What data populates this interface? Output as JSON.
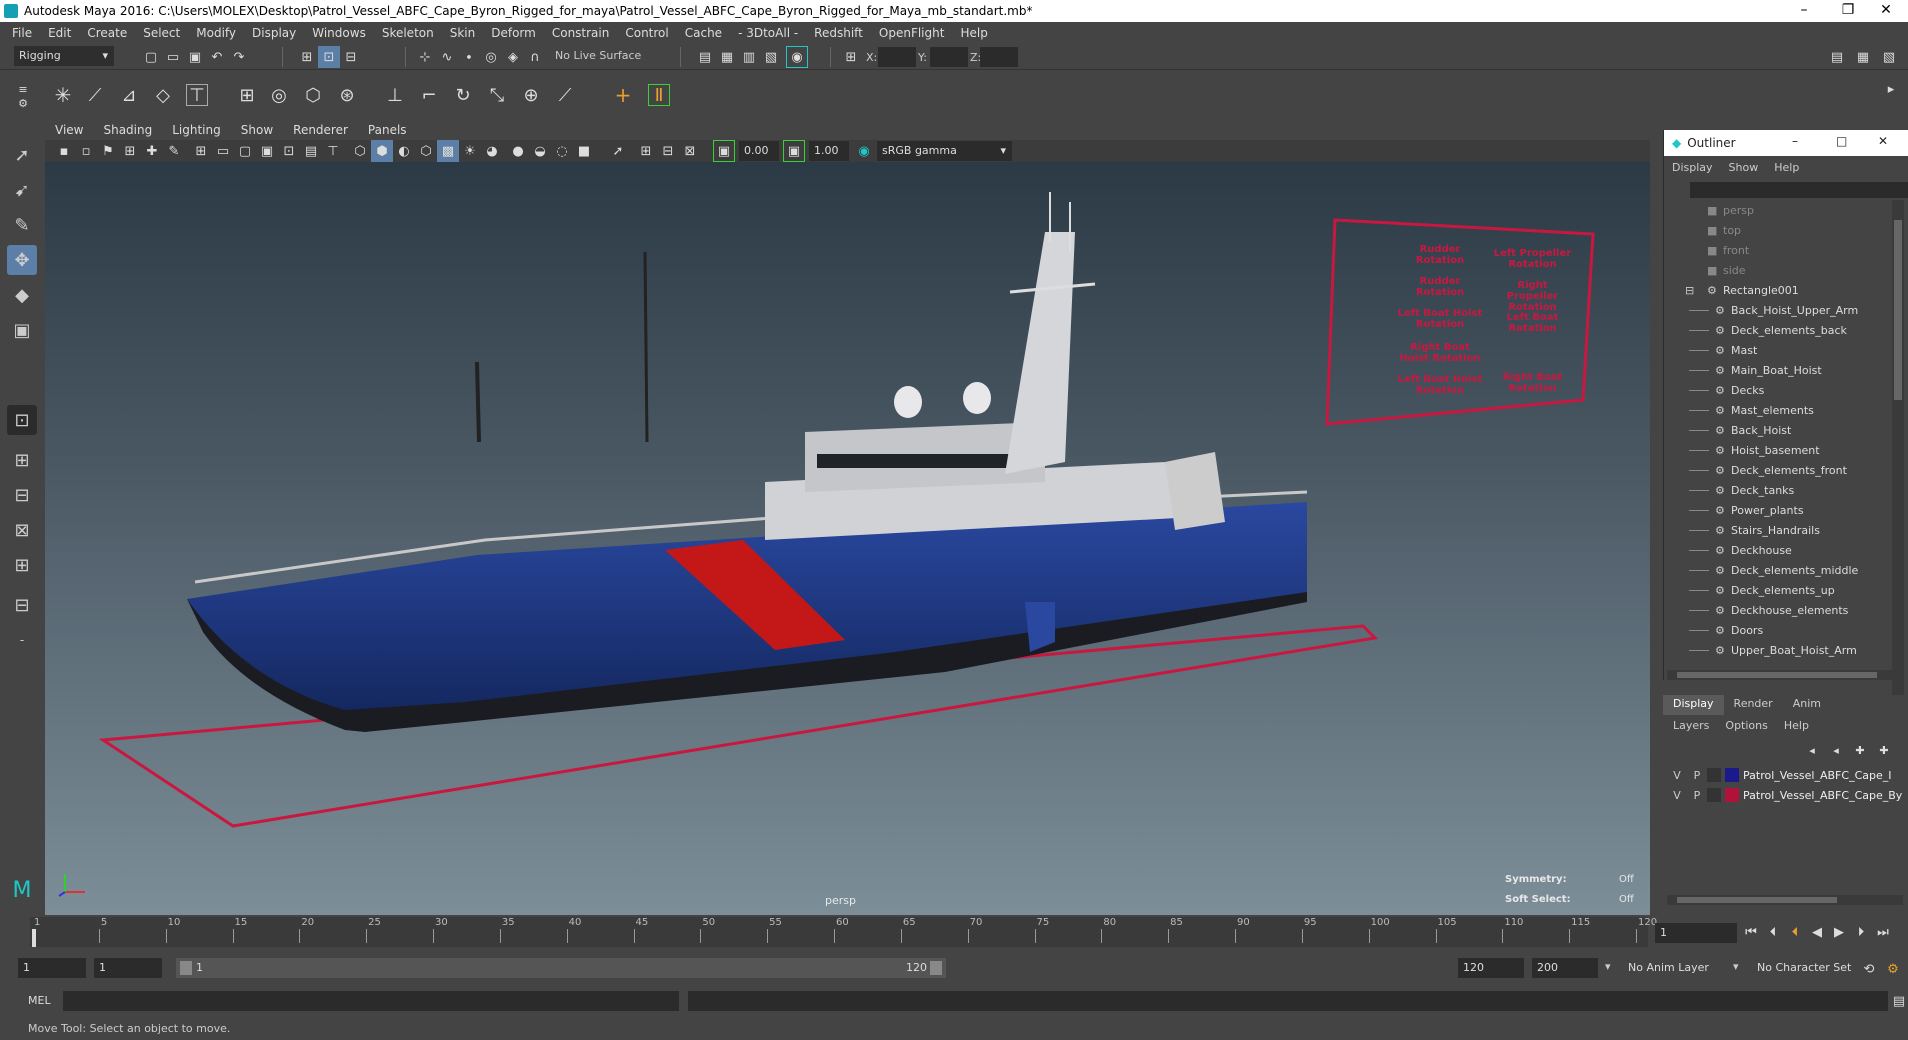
{
  "title": "Autodesk Maya 2016: C:\\Users\\MOLEX\\Desktop\\Patrol_Vessel_ABFC_Cape_Byron_Rigged_for_maya\\Patrol_Vessel_ABFC_Cape_Byron_Rigged_for_Maya_mb_standart.mb*",
  "menu": [
    "File",
    "Edit",
    "Create",
    "Select",
    "Modify",
    "Display",
    "Windows",
    "Skeleton",
    "Skin",
    "Deform",
    "Constrain",
    "Control",
    "Cache",
    "- 3DtoAll -",
    "Redshift",
    "OpenFlight",
    "Help"
  ],
  "status": {
    "mode": "Rigging",
    "live_surface": "No Live Surface",
    "x": "X:",
    "y": "Y:",
    "z": "Z:"
  },
  "panel_menu": [
    "View",
    "Shading",
    "Lighting",
    "Show",
    "Renderer",
    "Panels"
  ],
  "panel_tools": {
    "val1": "0.00",
    "val2": "1.00",
    "color_space": "sRGB gamma"
  },
  "viewport": {
    "camera": "persp",
    "symmetry_label": "Symmetry:",
    "symmetry_value": "Off",
    "soft_label": "Soft Select:",
    "soft_value": "Off"
  },
  "controls_panel": [
    "Rudder Rotation",
    "Left Propeller Rotation",
    "Rudder Rotation",
    "Right Propeller Rotation",
    "Left Boat Hoist Rotation",
    "Left Boat Rotation",
    "Right Boat Hoist Rotation",
    "Left Boat Hoist Rotation",
    "Right Boat Rotation"
  ],
  "outliner": {
    "title": "Outliner",
    "menu": [
      "Display",
      "Show",
      "Help"
    ],
    "items": [
      {
        "label": "persp",
        "indent": 0,
        "dim": true
      },
      {
        "label": "top",
        "indent": 0,
        "dim": true
      },
      {
        "label": "front",
        "indent": 0,
        "dim": true
      },
      {
        "label": "side",
        "indent": 0,
        "dim": true
      },
      {
        "label": "Rectangle001",
        "indent": 0,
        "dim": false
      },
      {
        "label": "Back_Hoist_Upper_Arm",
        "indent": 1,
        "dim": false
      },
      {
        "label": "Deck_elements_back",
        "indent": 1,
        "dim": false
      },
      {
        "label": "Mast",
        "indent": 1,
        "dim": false
      },
      {
        "label": "Main_Boat_Hoist",
        "indent": 1,
        "dim": false
      },
      {
        "label": "Decks",
        "indent": 1,
        "dim": false
      },
      {
        "label": "Mast_elements",
        "indent": 1,
        "dim": false
      },
      {
        "label": "Back_Hoist",
        "indent": 1,
        "dim": false
      },
      {
        "label": "Hoist_basement",
        "indent": 1,
        "dim": false
      },
      {
        "label": "Deck_elements_front",
        "indent": 1,
        "dim": false
      },
      {
        "label": "Deck_tanks",
        "indent": 1,
        "dim": false
      },
      {
        "label": "Power_plants",
        "indent": 1,
        "dim": false
      },
      {
        "label": "Stairs_Handrails",
        "indent": 1,
        "dim": false
      },
      {
        "label": "Deckhouse",
        "indent": 1,
        "dim": false
      },
      {
        "label": "Deck_elements_middle",
        "indent": 1,
        "dim": false
      },
      {
        "label": "Deck_elements_up",
        "indent": 1,
        "dim": false
      },
      {
        "label": "Deckhouse_elements",
        "indent": 1,
        "dim": false
      },
      {
        "label": "Doors",
        "indent": 1,
        "dim": false
      },
      {
        "label": "Upper_Boat_Hoist_Arm",
        "indent": 1,
        "dim": false
      }
    ]
  },
  "layers": {
    "tabs": [
      "Display",
      "Render",
      "Anim"
    ],
    "menu": [
      "Layers",
      "Options",
      "Help"
    ],
    "rows": [
      {
        "v": "V",
        "p": "P",
        "color": "#1a1a8a",
        "name": "Patrol_Vessel_ABFC_Cape_I"
      },
      {
        "v": "V",
        "p": "P",
        "color": "#b0123a",
        "name": "Patrol_Vessel_ABFC_Cape_By"
      }
    ]
  },
  "timeline": {
    "ticks": [
      "1",
      "5",
      "10",
      "15",
      "20",
      "25",
      "30",
      "35",
      "40",
      "45",
      "50",
      "55",
      "60",
      "65",
      "70",
      "75",
      "80",
      "85",
      "90",
      "95",
      "100",
      "105",
      "110",
      "115",
      "120"
    ],
    "current": "1"
  },
  "range": {
    "start": "1",
    "start2": "1",
    "inner_start": "1",
    "inner_end": "120",
    "end": "120",
    "end2": "200",
    "anim_layer": "No Anim Layer",
    "char_set": "No Character Set"
  },
  "cmd": {
    "label": "MEL"
  },
  "help": "Move Tool: Select an object to move."
}
